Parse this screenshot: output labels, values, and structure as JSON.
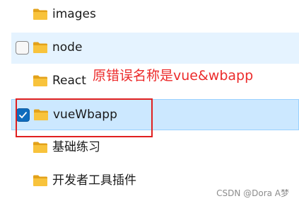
{
  "items": [
    {
      "label": "images",
      "icon": "folder-icon"
    },
    {
      "label": "node",
      "icon": "folder-icon",
      "state": "hover-unchecked"
    },
    {
      "label": "React",
      "icon": "folder-icon"
    },
    {
      "label": "vueWbapp",
      "icon": "folder-icon",
      "state": "selected-checked"
    },
    {
      "label": "基础练习",
      "icon": "folder-icon"
    },
    {
      "label": "开发者工具插件",
      "icon": "folder-icon"
    }
  ],
  "annotation": {
    "text": "原错误名称是vue&wbapp",
    "color": "#ec2b2b"
  },
  "watermark": "CSDN @Dora A梦",
  "colors": {
    "hover_bg": "#e5f3ff",
    "selected_bg": "#cce8ff",
    "checkbox_checked": "#0f6cbd",
    "folder_yellow": "#f8c33c",
    "highlight_border": "#e02020"
  }
}
